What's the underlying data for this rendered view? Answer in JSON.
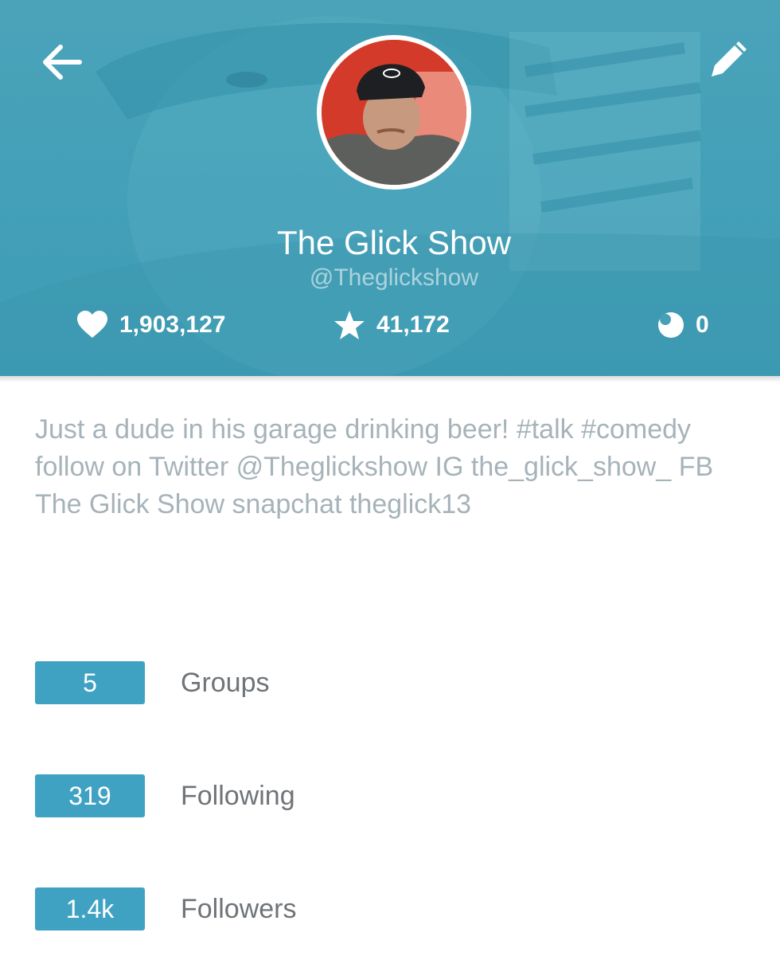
{
  "header": {
    "display_name": "The Glick Show",
    "handle": "@Theglickshow",
    "background_color": "#43a0b8"
  },
  "nav": {
    "back_icon": "arrow-left-icon",
    "edit_icon": "pencil-icon"
  },
  "stats": [
    {
      "icon": "heart-icon",
      "value": "1,903,127"
    },
    {
      "icon": "star-icon",
      "value": "41,172"
    },
    {
      "icon": "moon-icon",
      "value": "0"
    }
  ],
  "bio": "Just a dude in his garage drinking beer! #talk #comedy follow on Twitter @Theglickshow IG the_glick_show_ FB The Glick Show snapchat theglick13",
  "counts": {
    "groups": {
      "count": "5",
      "label": "Groups"
    },
    "following": {
      "count": "319",
      "label": "Following"
    },
    "followers": {
      "count": "1.4k",
      "label": "Followers"
    }
  },
  "colors": {
    "accent": "#3fa2c3",
    "bio_text": "#a6b3b9",
    "label_text": "#6f7478"
  }
}
